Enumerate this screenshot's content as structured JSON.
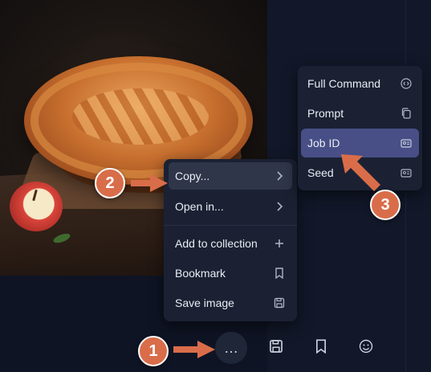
{
  "context_menu": {
    "items": [
      {
        "label": "Copy...",
        "icon": "chevron-right-icon"
      },
      {
        "label": "Open in...",
        "icon": "chevron-right-icon"
      },
      {
        "label": "Add to collection",
        "icon": "plus-icon"
      },
      {
        "label": "Bookmark",
        "icon": "bookmark-icon"
      },
      {
        "label": "Save image",
        "icon": "save-icon"
      }
    ]
  },
  "copy_submenu": {
    "items": [
      {
        "label": "Full Command",
        "icon": "code-icon"
      },
      {
        "label": "Prompt",
        "icon": "copy-icon"
      },
      {
        "label": "Job ID",
        "icon": "id-card-icon"
      },
      {
        "label": "Seed",
        "icon": "id-card-icon"
      }
    ]
  },
  "toolbar": {
    "more_icon": "…",
    "icons": [
      "more-icon",
      "save-icon",
      "bookmark-icon",
      "emoji-icon"
    ]
  },
  "annotations": {
    "step1": "1",
    "step2": "2",
    "step3": "3",
    "color": "#d96d4a"
  },
  "colors": {
    "background": "#0f1424",
    "menu": "#1b2133",
    "menu_active": "#2f3649",
    "submenu_active": "#474f86"
  }
}
